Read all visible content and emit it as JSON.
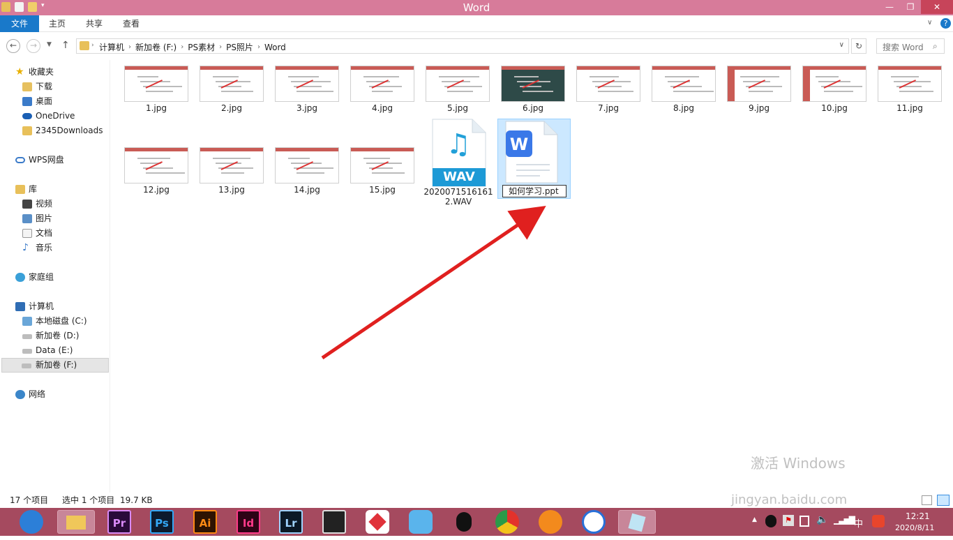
{
  "window": {
    "title": "Word"
  },
  "ribbon": {
    "file": "文件",
    "home": "主页",
    "share": "共享",
    "view": "查看"
  },
  "address": {
    "crumbs": [
      "计算机",
      "新加卷 (F:)",
      "PS素材",
      "PS照片",
      "Word"
    ],
    "search_placeholder": "搜索 Word"
  },
  "sidebar": {
    "favorites": "收藏夹",
    "downloads": "下载",
    "desktop": "桌面",
    "onedrive": "OneDrive",
    "dl2345": "2345Downloads",
    "wps": "WPS网盘",
    "library": "库",
    "video": "视频",
    "pictures": "图片",
    "docs": "文档",
    "music": "音乐",
    "homegroup": "家庭组",
    "computer": "计算机",
    "drive_c": "本地磁盘 (C:)",
    "drive_d": "新加卷 (D:)",
    "drive_e": "Data (E:)",
    "drive_f": "新加卷 (F:)",
    "network": "网络"
  },
  "files": [
    "1.jpg",
    "2.jpg",
    "3.jpg",
    "4.jpg",
    "5.jpg",
    "6.jpg",
    "7.jpg",
    "8.jpg",
    "9.jpg",
    "10.jpg",
    "11.jpg",
    "12.jpg",
    "13.jpg",
    "14.jpg",
    "15.jpg"
  ],
  "wav": {
    "badge": "WAV",
    "name1": "2020071516161",
    "name2": "2.WAV"
  },
  "ppt": {
    "rename_value": "如何学习.ppt"
  },
  "status": {
    "count": "17 个项目",
    "selected": "选中 1 个项目",
    "size": "19.7 KB"
  },
  "taskbar": {
    "pr": "Pr",
    "ps": "Ps",
    "ai": "Ai",
    "id": "Id",
    "lr": "Lr"
  },
  "tray": {
    "ime": "中",
    "time": "12:21",
    "date": "2020/8/11"
  },
  "watermark": {
    "line1": "激活 Windows",
    "line2": "jingyan.baidu.com"
  }
}
